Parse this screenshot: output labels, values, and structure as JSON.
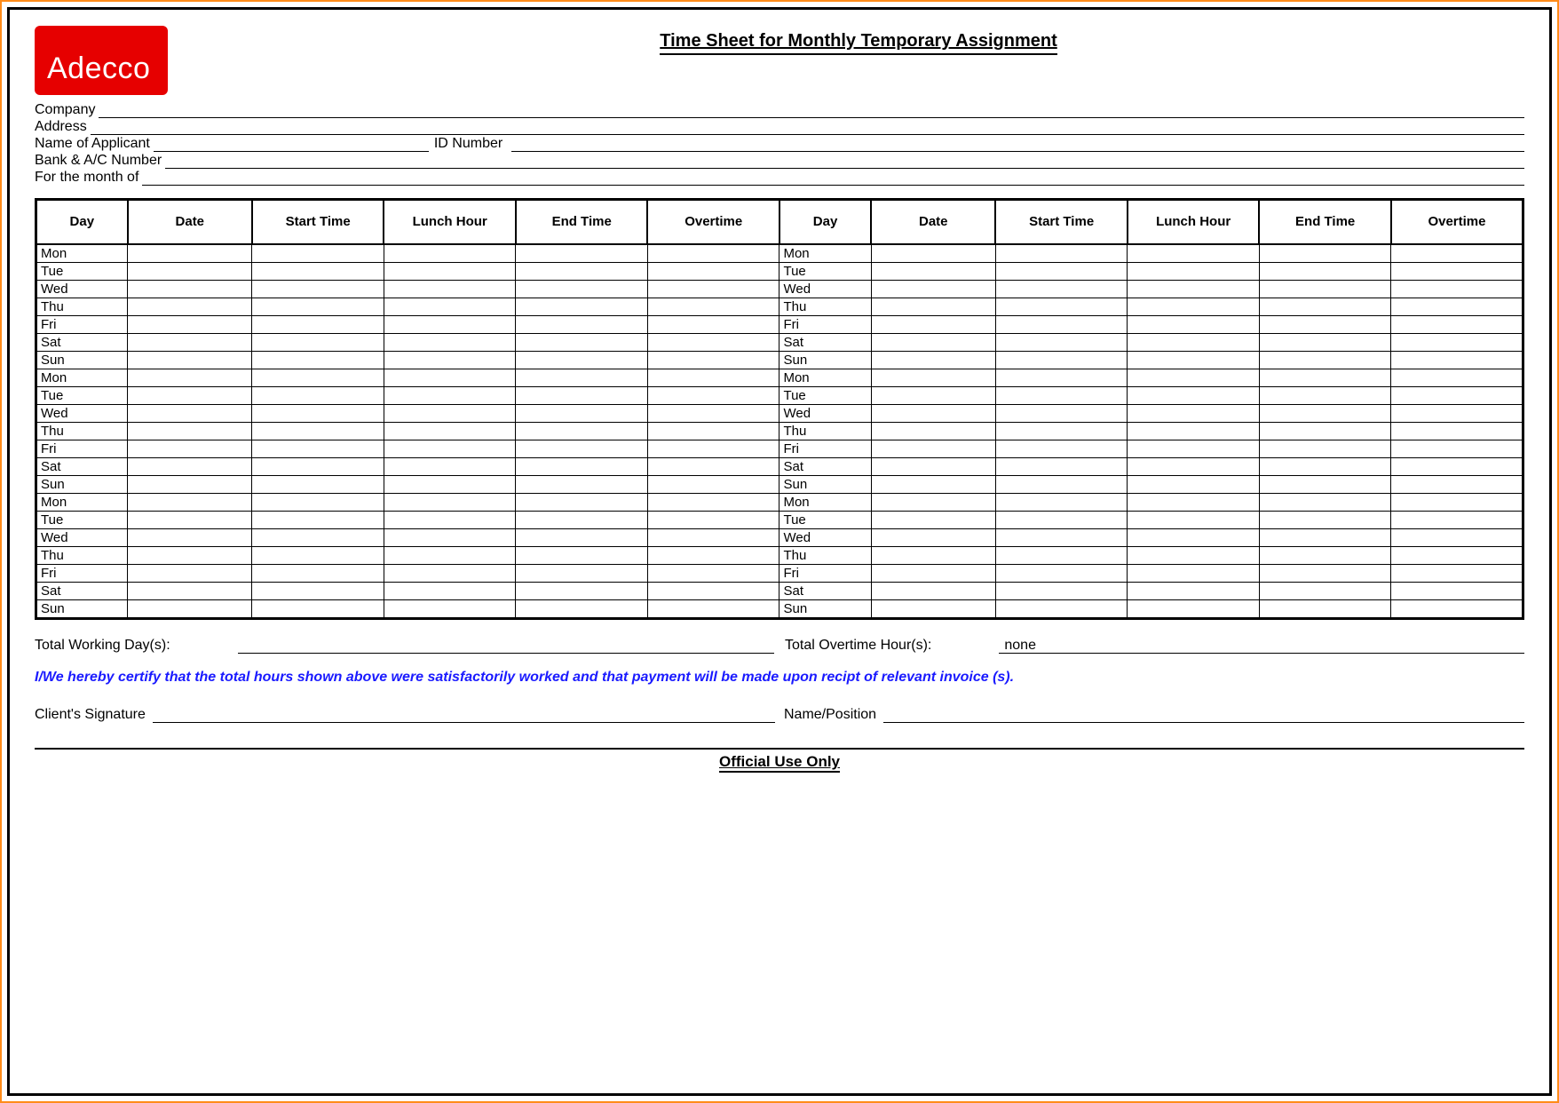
{
  "logo_text": "Adecco",
  "title": "Time Sheet for Monthly Temporary Assignment",
  "info": {
    "company_label": "Company",
    "address_label": "Address",
    "applicant_label": "Name of Applicant",
    "id_label": "ID Number",
    "bank_label": "Bank & A/C Number",
    "month_label": "For the month of"
  },
  "columns": [
    "Day",
    "Date",
    "Start Time",
    "Lunch Hour",
    "End Time",
    "Overtime",
    "Day",
    "Date",
    "Start Time",
    "Lunch Hour",
    "End Time",
    "Overtime"
  ],
  "days": [
    "Mon",
    "Tue",
    "Wed",
    "Thu",
    "Fri",
    "Sat",
    "Sun",
    "Mon",
    "Tue",
    "Wed",
    "Thu",
    "Fri",
    "Sat",
    "Sun",
    "Mon",
    "Tue",
    "Wed",
    "Thu",
    "Fri",
    "Sat",
    "Sun"
  ],
  "totals": {
    "working_days_label": "Total Working Day(s):",
    "overtime_label": "Total Overtime Hour(s):",
    "overtime_value": "none"
  },
  "certification": "I/We hereby certify that the total hours shown above were satisfactorily worked and that payment will be made upon recipt of relevant invoice (s).",
  "signature": {
    "client_label": "Client's Signature",
    "name_label": "Name/Position"
  },
  "official_use": "Official Use Only"
}
